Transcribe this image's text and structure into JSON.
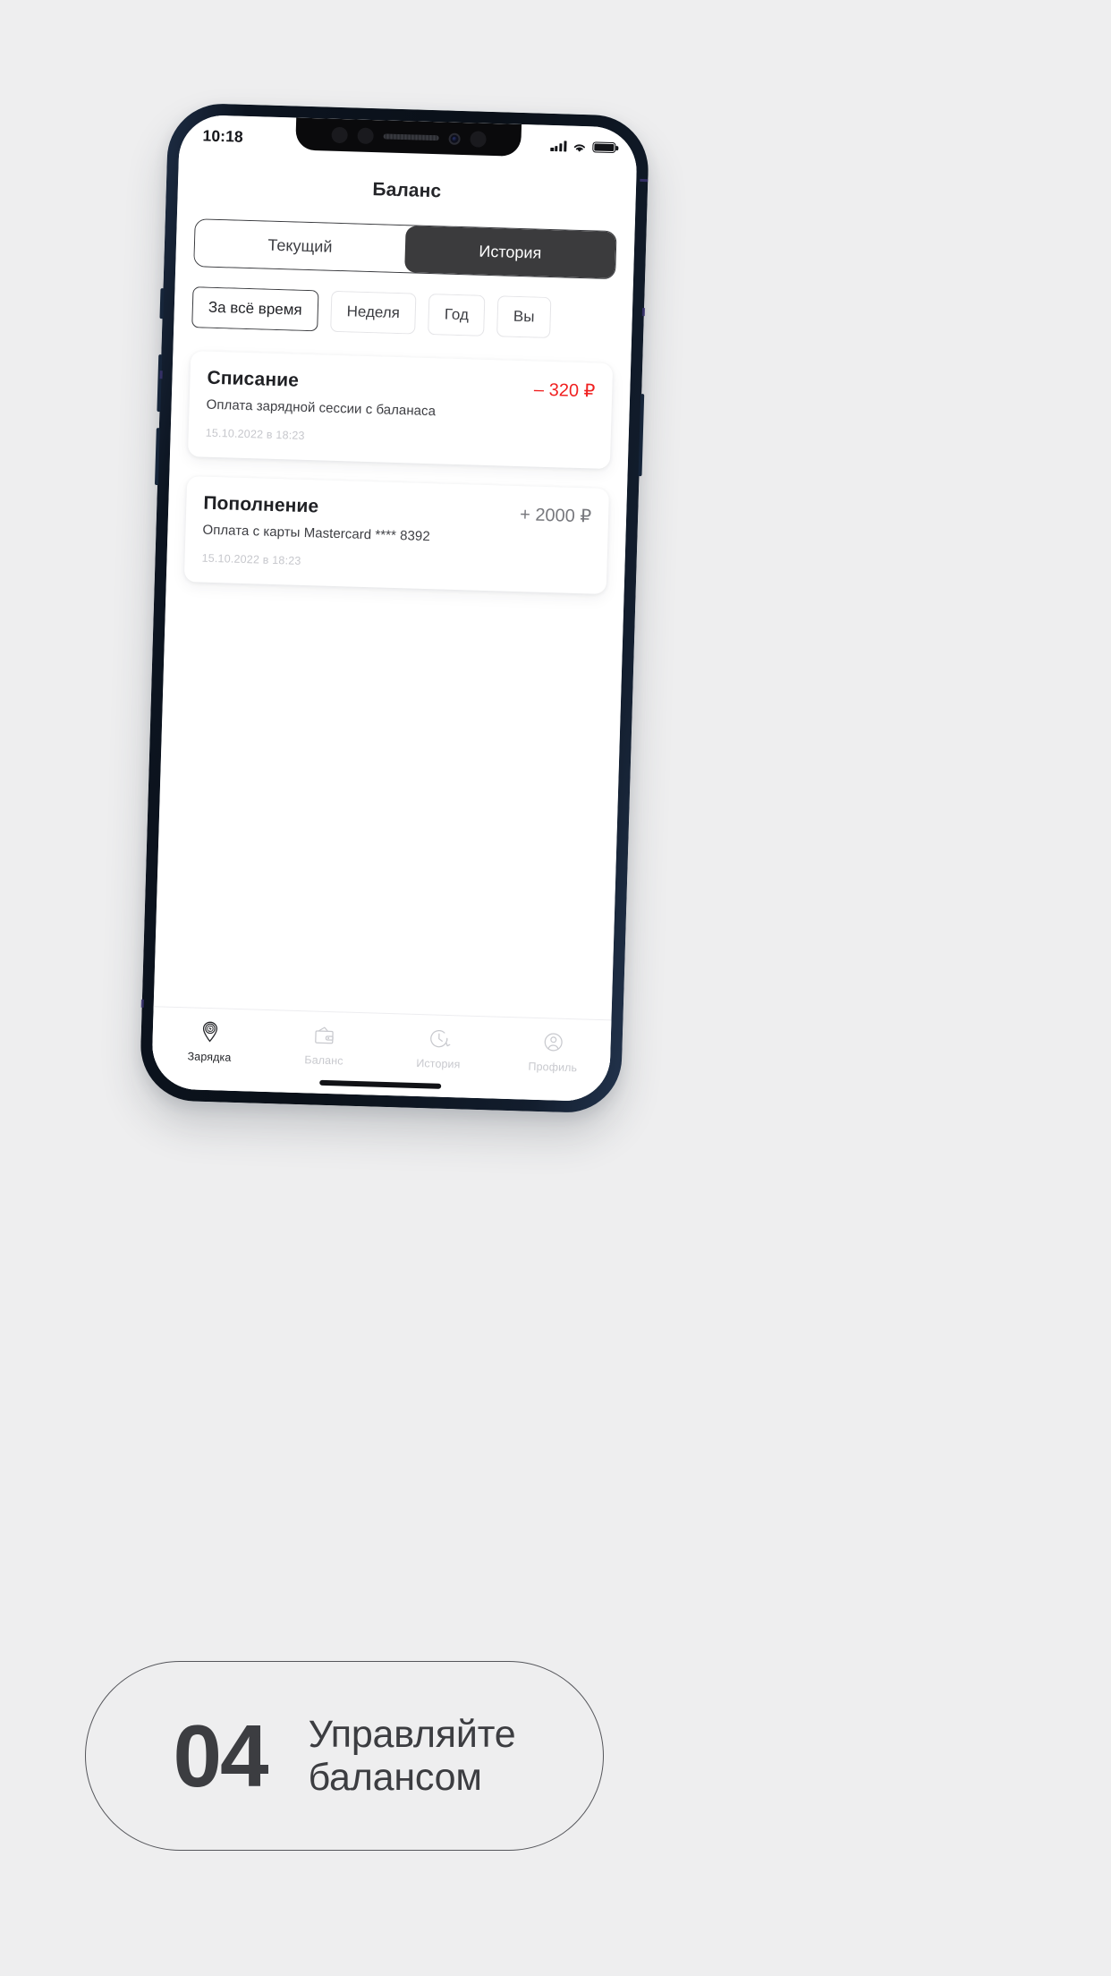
{
  "background_color": "#eeeeef",
  "phone": {
    "bezel_color": "#121c2b",
    "screen_background": "#ffffff"
  },
  "status_bar": {
    "time": "10:18",
    "icons": [
      "signal-bars-icon",
      "wifi-icon",
      "battery-full-icon"
    ],
    "battery_level_percent": 100
  },
  "header": {
    "title": "Баланс"
  },
  "segmented_control": {
    "options": [
      {
        "label": "Текущий",
        "active": false
      },
      {
        "label": "История",
        "active": true
      }
    ],
    "active_background": "#3b3b3d",
    "active_text_color": "#ffffff"
  },
  "filter_chips": [
    {
      "label": "За всё время",
      "selected": true
    },
    {
      "label": "Неделя",
      "selected": false
    },
    {
      "label": "Год",
      "selected": false
    },
    {
      "label": "Вы",
      "selected": false,
      "truncated": true
    }
  ],
  "transactions": [
    {
      "title": "Списание",
      "description": "Оплата зарядной сессии с баланаса",
      "date": "15.10.2022 в 18:23",
      "amount": "– 320 ₽",
      "amount_sign": "negative",
      "amount_color": "#f01f1f"
    },
    {
      "title": "Пополнение",
      "description": "Оплата с карты Mastercard **** 8392",
      "date": "15.10.2022 в 18:23",
      "amount": "+ 2000 ₽",
      "amount_sign": "positive",
      "amount_color": "#77787d"
    }
  ],
  "tab_bar": [
    {
      "label": "Зарядка",
      "icon": "charge-pin-icon",
      "active": true
    },
    {
      "label": "Баланс",
      "icon": "wallet-icon",
      "active": false
    },
    {
      "label": "История",
      "icon": "clock-history-icon",
      "active": false
    },
    {
      "label": "Профиль",
      "icon": "user-circle-icon",
      "active": false
    }
  ],
  "caption": {
    "number": "04",
    "line1": "Управляйте",
    "line2": "балансом",
    "text_color": "#3c3d41"
  }
}
